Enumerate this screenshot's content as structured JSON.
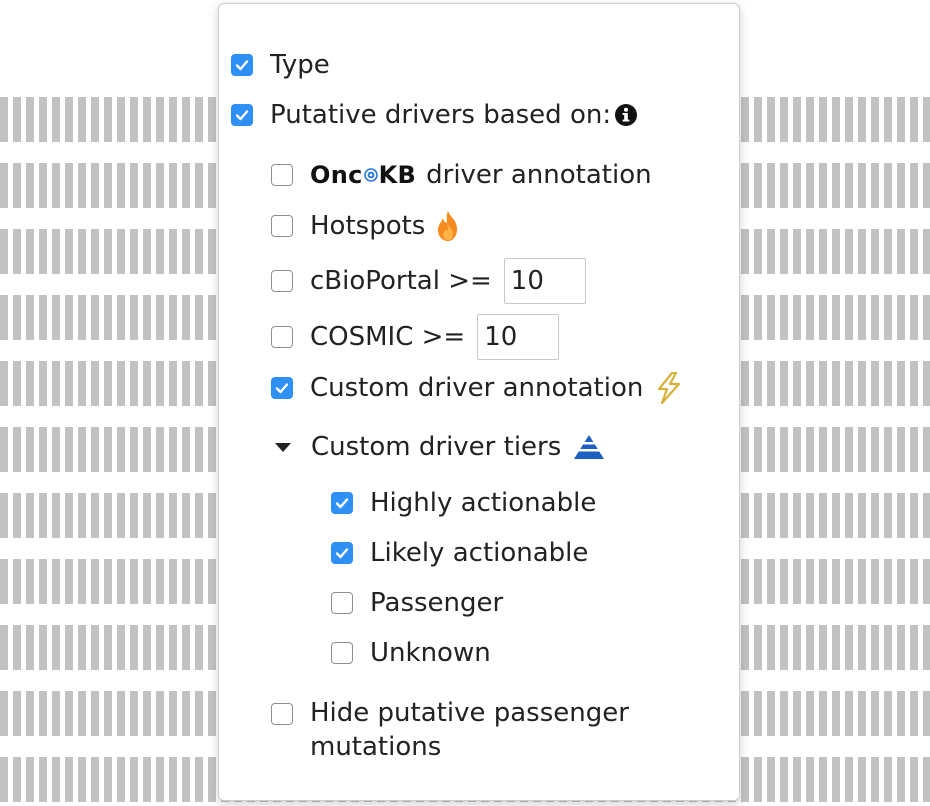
{
  "options": {
    "type_label": "Type",
    "type_checked": true,
    "putative_label": "Putative drivers based on:",
    "putative_checked": true
  },
  "drivers": {
    "oncokb_logo": {
      "pre": "Onc",
      "post": "KB"
    },
    "oncokb_label": "driver annotation",
    "oncokb_checked": false,
    "hotspots_label": "Hotspots",
    "hotspots_checked": false,
    "cbioportal_label": "cBioPortal >=",
    "cbioportal_checked": false,
    "cbioportal_value": "10",
    "cosmic_label": "COSMIC >=",
    "cosmic_checked": false,
    "cosmic_value": "10",
    "custom_label": "Custom driver annotation",
    "custom_checked": true,
    "tiers_label": "Custom driver tiers"
  },
  "tiers": [
    {
      "label": "Highly actionable",
      "checked": true
    },
    {
      "label": "Likely actionable",
      "checked": true
    },
    {
      "label": "Passenger",
      "checked": false
    },
    {
      "label": "Unknown",
      "checked": false
    }
  ],
  "hide_passenger": {
    "line1": "Hide putative passenger",
    "line2": "mutations",
    "checked": false
  },
  "icons": {
    "info": "info-circle-icon",
    "hotspot": "flame-icon",
    "custom": "lightning-bolt-icon",
    "tiers": "pyramid-icon",
    "toggle": "caret-down-icon",
    "check": "checkmark-icon"
  },
  "colors": {
    "checkbox_checked": "#2e8ff5",
    "flame_outer": "#f58a1f",
    "flame_inner": "#ffb347",
    "bolt": "#d6b23a",
    "pyramid": "#1f5fbf",
    "background_bars": "#c2c2c2"
  }
}
